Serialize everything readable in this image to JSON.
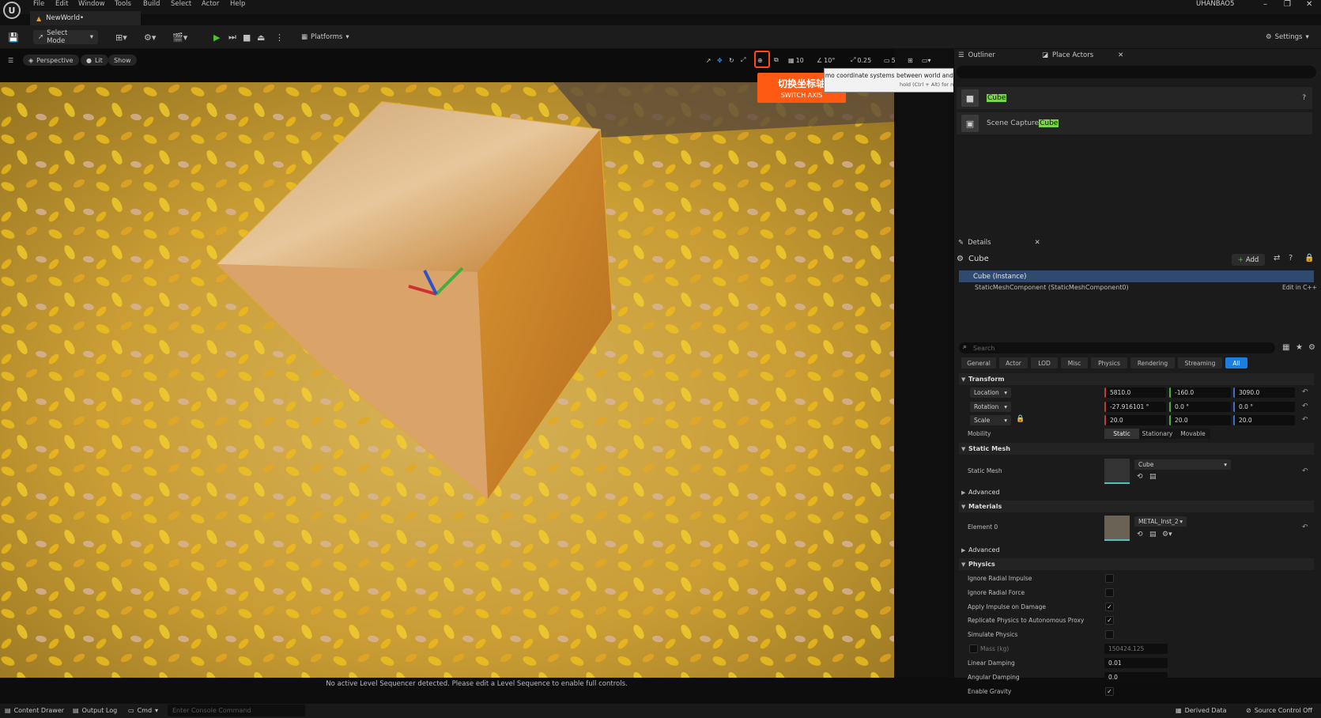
{
  "menubar": {
    "logo": "U",
    "items": [
      "File",
      "Edit",
      "Window",
      "Tools",
      "Build",
      "Select",
      "Actor",
      "Help"
    ],
    "username": "UHANBAO5",
    "window_controls": [
      "–",
      "❐",
      "✕"
    ]
  },
  "level_tab": {
    "icon": "level-icon",
    "label": "NewWorld•"
  },
  "toolbar": {
    "select_mode": "Select Mode",
    "platforms": "Platforms",
    "settings": "Settings"
  },
  "viewport": {
    "perspective": "Perspective",
    "lit": "Lit",
    "show": "Show",
    "grid_snap": "10",
    "rotate_snap": "10°",
    "scale_snap": "0.25",
    "camera_speed": "5",
    "sequencer_message": "No active Level Sequencer detected. Please edit a Level Sequence to enable full controls."
  },
  "tooltip": {
    "title_cn": "切换坐标轴",
    "title_en": "SWITCH AXIS",
    "text": "mo coordinate systems between world and local (object) space (Ctrl+`)",
    "subtext": "hold (Ctrl + Alt) for more"
  },
  "outliner": {
    "tab_outliner": "Outliner",
    "tab_place_actors": "Place Actors",
    "rows": [
      {
        "prefix": "",
        "highlight": "Cube"
      },
      {
        "prefix": "Scene Capture ",
        "highlight": "Cube"
      }
    ]
  },
  "details": {
    "tab": "Details",
    "title": "Cube",
    "add": "Add",
    "instance": "Cube (Instance)",
    "component": "StaticMeshComponent (StaticMeshComponent0)",
    "edit_cpp": "Edit in C++",
    "search_placeholder": "Search",
    "filters": [
      "General",
      "Actor",
      "LOD",
      "Misc",
      "Physics",
      "Rendering",
      "Streaming",
      "All"
    ],
    "transform": {
      "section": "Transform",
      "location_label": "Location",
      "location": [
        "5810.0",
        "-160.0",
        "3090.0"
      ],
      "rotation_label": "Rotation",
      "rotation": [
        "-27.916101 °",
        "0.0 °",
        "0.0 °"
      ],
      "scale_label": "Scale",
      "scale": [
        "20.0",
        "20.0",
        "20.0"
      ],
      "mobility_label": "Mobility",
      "mobility": [
        "Static",
        "Stationary",
        "Movable"
      ]
    },
    "static_mesh": {
      "section": "Static Mesh",
      "label": "Static Mesh",
      "value": "Cube",
      "advanced": "Advanced"
    },
    "materials": {
      "section": "Materials",
      "label": "Element 0",
      "value": "METAL_Inst_2",
      "advanced": "Advanced"
    },
    "physics": {
      "section": "Physics",
      "ignore_radial_impulse": "Ignore Radial Impulse",
      "ignore_radial_force": "Ignore Radial Force",
      "apply_impulse": "Apply Impulse on Damage",
      "replicate": "Replicate Physics to Autonomous Proxy",
      "simulate": "Simulate Physics",
      "mass_label": "Mass (kg)",
      "mass_value": "150424.125",
      "linear_damping_label": "Linear Damping",
      "linear_damping": "0.01",
      "angular_damping_label": "Angular Damping",
      "angular_damping": "0.0",
      "enable_gravity": "Enable Gravity",
      "check": "✓"
    }
  },
  "statusbar": {
    "content_drawer": "Content Drawer",
    "output_log": "Output Log",
    "cmd": "Cmd",
    "console_placeholder": "Enter Console Command",
    "derived_data": "Derived Data",
    "source_control": "Source Control Off"
  }
}
